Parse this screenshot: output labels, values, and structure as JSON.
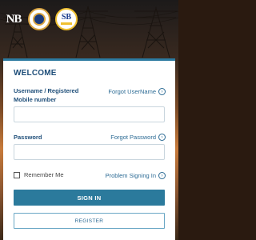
{
  "header": {
    "logos": [
      {
        "name": "nb-logo",
        "text": "NB"
      },
      {
        "name": "emblem-logo",
        "text": ""
      },
      {
        "name": "sb-logo",
        "text": "SB"
      }
    ]
  },
  "login": {
    "welcome": "WELCOME",
    "username_label": "Username / Registered Mobile number",
    "forgot_username": "Forgot UserName",
    "username_value": "",
    "password_label": "Password",
    "forgot_password": "Forgot Password",
    "password_value": "",
    "remember_me": "Remember Me",
    "problem_signing_in": "Problem Signing In",
    "sign_in": "SIGN IN",
    "register": "REGISTER"
  },
  "colors": {
    "accent": "#2b7a9c",
    "title": "#1e4e79",
    "link": "#2b6a94"
  },
  "icons": {
    "forgot_username_icon": "arrow-circle-icon",
    "forgot_password_icon": "arrow-circle-icon",
    "problem_icon": "arrow-circle-icon"
  }
}
